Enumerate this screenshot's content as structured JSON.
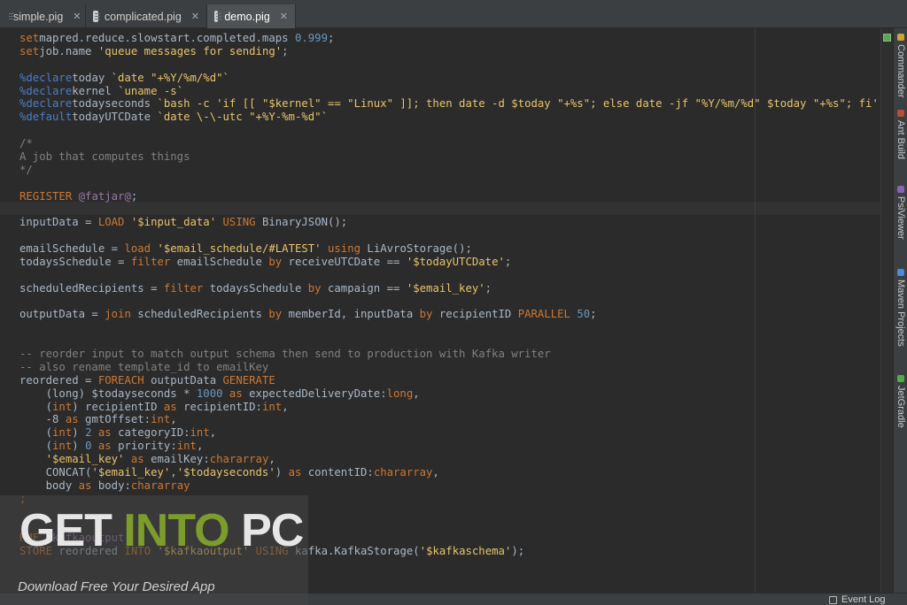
{
  "tabs": [
    {
      "label": "simple.pig",
      "active": false
    },
    {
      "label": "complicated.pig",
      "active": false
    },
    {
      "label": "demo.pig",
      "active": true
    }
  ],
  "code_lines": [
    [
      [
        "kw",
        "set"
      ],
      [
        "",
        "mapred.reduce.slowstart.completed.maps "
      ],
      [
        "num",
        "0.999"
      ],
      [
        "",
        ";"
      ]
    ],
    [
      [
        "kw",
        "set"
      ],
      [
        "",
        "job.name "
      ],
      [
        "str",
        "'queue messages for sending'"
      ],
      [
        "",
        ";"
      ]
    ],
    [],
    [
      [
        "decl",
        "%declare"
      ],
      [
        "",
        "today "
      ],
      [
        "str",
        "`date \"+%Y/%m/%d\"`"
      ]
    ],
    [
      [
        "decl",
        "%declare"
      ],
      [
        "",
        "kernel "
      ],
      [
        "str",
        "`uname -s`"
      ]
    ],
    [
      [
        "decl",
        "%declare"
      ],
      [
        "",
        "todayseconds "
      ],
      [
        "str",
        "`bash -c 'if [[ \"$kernel\" == \"Linux\" ]]; then date -d $today \"+%s\"; else date -jf \"%Y/%m/%d\" $today \"+%s\"; fi'`"
      ]
    ],
    [
      [
        "decl",
        "%default"
      ],
      [
        "",
        "todayUTCDate "
      ],
      [
        "str",
        "`date \\-\\-utc \"+%Y-%m-%d\"`"
      ]
    ],
    [],
    [
      [
        "cmt",
        "/*"
      ]
    ],
    [
      [
        "cmt",
        "A job that computes things"
      ]
    ],
    [
      [
        "cmt",
        "*/"
      ]
    ],
    [],
    [
      [
        "kw",
        "REGISTER"
      ],
      [
        "",
        " "
      ],
      [
        "ann",
        "@fatjar@"
      ],
      [
        "",
        ";"
      ]
    ],
    [],
    [
      [
        "",
        "inputData = "
      ],
      [
        "kw",
        "LOAD"
      ],
      [
        "",
        " "
      ],
      [
        "str",
        "'$input_data'"
      ],
      [
        "",
        " "
      ],
      [
        "kw",
        "USING"
      ],
      [
        "",
        " BinaryJSON();"
      ]
    ],
    [],
    [
      [
        "",
        "emailSchedule = "
      ],
      [
        "kw",
        "load"
      ],
      [
        "",
        " "
      ],
      [
        "str",
        "'$email_schedule/#LATEST'"
      ],
      [
        "",
        " "
      ],
      [
        "kw",
        "using"
      ],
      [
        "",
        " LiAvroStorage();"
      ]
    ],
    [
      [
        "",
        "todaysSchedule = "
      ],
      [
        "kw",
        "filter"
      ],
      [
        "",
        " emailSchedule "
      ],
      [
        "kw",
        "by"
      ],
      [
        "",
        " receiveUTCDate == "
      ],
      [
        "str",
        "'$todayUTCDate'"
      ],
      [
        "",
        ";"
      ]
    ],
    [],
    [
      [
        "",
        "scheduledRecipients = "
      ],
      [
        "kw",
        "filter"
      ],
      [
        "",
        " todaysSchedule "
      ],
      [
        "kw",
        "by"
      ],
      [
        "",
        " campaign == "
      ],
      [
        "str",
        "'$email_key'"
      ],
      [
        "",
        ";"
      ]
    ],
    [],
    [
      [
        "",
        "outputData = "
      ],
      [
        "kw",
        "join"
      ],
      [
        "",
        " scheduledRecipients "
      ],
      [
        "kw",
        "by"
      ],
      [
        "",
        " memberId, inputData "
      ],
      [
        "kw",
        "by"
      ],
      [
        "",
        " recipientID "
      ],
      [
        "kw",
        "PARALLEL"
      ],
      [
        "",
        " "
      ],
      [
        "num",
        "50"
      ],
      [
        "",
        ";"
      ]
    ],
    [],
    [],
    [
      [
        "cmt",
        "-- reorder input to match output schema then send to production with Kafka writer"
      ]
    ],
    [
      [
        "cmt",
        "-- also rename template_id to emailKey"
      ]
    ],
    [
      [
        "",
        "reordered = "
      ],
      [
        "kw",
        "FOREACH"
      ],
      [
        "",
        " outputData "
      ],
      [
        "kw",
        "GENERATE"
      ]
    ],
    [
      [
        "",
        "    (long) $todayseconds * "
      ],
      [
        "num",
        "1000"
      ],
      [
        "",
        " "
      ],
      [
        "kw",
        "as"
      ],
      [
        "",
        " expectedDeliveryDate:"
      ],
      [
        "typ",
        "long"
      ],
      [
        "",
        ","
      ]
    ],
    [
      [
        "",
        "    ("
      ],
      [
        "typ",
        "int"
      ],
      [
        "",
        ") recipientID "
      ],
      [
        "kw",
        "as"
      ],
      [
        "",
        " recipientID:"
      ],
      [
        "typ",
        "int"
      ],
      [
        "",
        ","
      ]
    ],
    [
      [
        "",
        "    -8 "
      ],
      [
        "kw",
        "as"
      ],
      [
        "",
        " gmtOffset:"
      ],
      [
        "typ",
        "int"
      ],
      [
        "",
        ","
      ]
    ],
    [
      [
        "",
        "    ("
      ],
      [
        "typ",
        "int"
      ],
      [
        "",
        ") "
      ],
      [
        "num",
        "2"
      ],
      [
        "",
        " "
      ],
      [
        "kw",
        "as"
      ],
      [
        "",
        " categoryID:"
      ],
      [
        "typ",
        "int"
      ],
      [
        "",
        ","
      ]
    ],
    [
      [
        "",
        "    ("
      ],
      [
        "typ",
        "int"
      ],
      [
        "",
        ") "
      ],
      [
        "num",
        "0"
      ],
      [
        "",
        " "
      ],
      [
        "kw",
        "as"
      ],
      [
        "",
        " priority:"
      ],
      [
        "typ",
        "int"
      ],
      [
        "",
        ","
      ]
    ],
    [
      [
        "",
        "    "
      ],
      [
        "str",
        "'$email_key'"
      ],
      [
        "",
        " "
      ],
      [
        "kw",
        "as"
      ],
      [
        "",
        " emailKey:"
      ],
      [
        "typ",
        "chararray"
      ],
      [
        "",
        ","
      ]
    ],
    [
      [
        "",
        "    CONCAT("
      ],
      [
        "str",
        "'$email_key'"
      ],
      [
        "",
        ","
      ],
      [
        "str",
        "'$todayseconds'"
      ],
      [
        "",
        ") "
      ],
      [
        "kw",
        "as"
      ],
      [
        "",
        " contentID:"
      ],
      [
        "typ",
        "chararray"
      ],
      [
        "",
        ","
      ]
    ],
    [
      [
        "",
        "    body "
      ],
      [
        "kw",
        "as"
      ],
      [
        "",
        " body:"
      ],
      [
        "typ",
        "chararray"
      ]
    ],
    [
      [
        "kw",
        ";"
      ]
    ],
    [],
    [],
    [
      [
        "kw",
        "RMF"
      ],
      [
        "",
        " "
      ],
      [
        "ann",
        "$kafkaoutput"
      ],
      [
        "",
        ";"
      ]
    ],
    [
      [
        "kw",
        "STORE"
      ],
      [
        "",
        " reordered "
      ],
      [
        "kw",
        "INTO"
      ],
      [
        "",
        " "
      ],
      [
        "str",
        "'$kafkaoutput'"
      ],
      [
        "",
        " "
      ],
      [
        "kw",
        "USING"
      ],
      [
        "",
        " kafka.KafkaStorage("
      ],
      [
        "str",
        "'$kafkaschema'"
      ],
      [
        "",
        ");"
      ]
    ]
  ],
  "tool_windows": [
    {
      "label": "Commander",
      "icon_color": "#c9a43a"
    },
    {
      "label": "Ant Build",
      "icon_color": "#b94c3a"
    },
    {
      "label": "PsiViewer",
      "icon_color": "#8a63b8"
    },
    {
      "label": "Maven Projects",
      "icon_color": "#4f8ad8"
    },
    {
      "label": "JetGradle",
      "icon_color": "#4fae4a"
    }
  ],
  "status": {
    "event_log": "Event Log"
  },
  "watermark": {
    "logo_part1": "GET ",
    "logo_part2": "INTO",
    "logo_part3": " PC",
    "tagline": "Download Free Your Desired App"
  },
  "colors": {
    "background": "#2b2b2b",
    "keyword": "#cc7832",
    "string": "#e8c46a",
    "number": "#6897bb",
    "comment": "#808080",
    "declare": "#4a7ec9",
    "inspection_ok": "#5fa35a"
  }
}
